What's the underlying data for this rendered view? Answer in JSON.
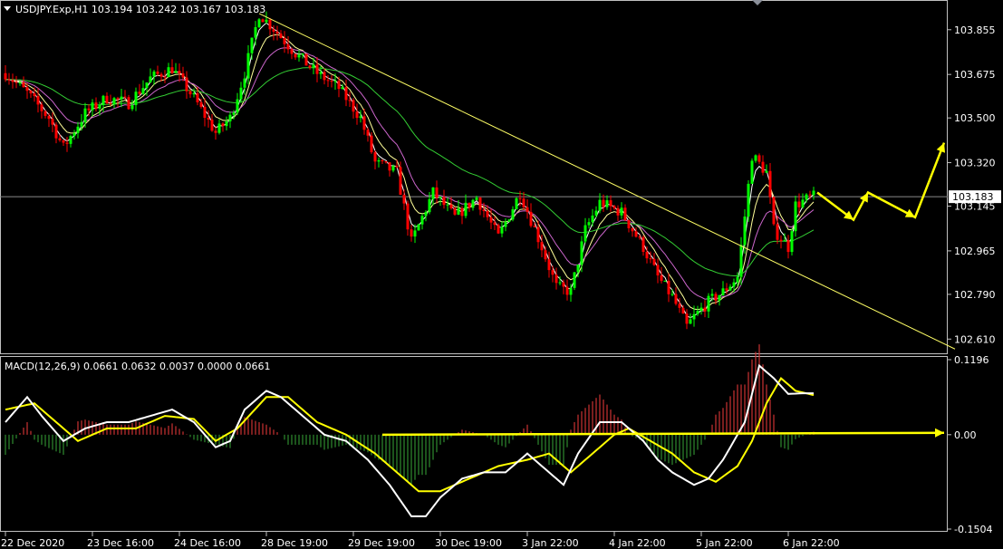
{
  "header": {
    "symbol_line": "USDJPY.Exp,H1  103.194 103.242 103.167 103.183"
  },
  "macd_header": {
    "label": "MACD(12,26,9) 0.0661 0.0632 0.0037 0.0000 0.0661"
  },
  "colors": {
    "background": "#000000",
    "bull": "#00ff00",
    "bear": "#ff0000",
    "trendline": "#ffff66",
    "arrow": "#ffff00",
    "ma_fast": "#ffffff",
    "ma_mid": "#ffff99",
    "ma_slow": "#cc66cc",
    "ma_long": "#33cc33",
    "macd_line": "#ffffff",
    "signal_line": "#ffff00",
    "hist_pos": "#cc3333",
    "hist_neg": "#2e8b2e"
  },
  "chart_data": [
    {
      "type": "candlestick",
      "title": "USDJPY.Exp,H1",
      "ylim": [
        102.56,
        103.96
      ],
      "y_ticks": [
        "103.855",
        "103.675",
        "103.500",
        "103.320",
        "103.145",
        "102.965",
        "102.790",
        "102.610"
      ],
      "y_tick_values": [
        103.855,
        103.675,
        103.5,
        103.32,
        103.145,
        102.965,
        102.79,
        102.61
      ],
      "current_price_label": "103.183",
      "current_price": 103.183,
      "x_ticks": [
        "22 Dec 2020",
        "23 Dec 16:00",
        "24 Dec 16:00",
        "28 Dec 19:00",
        "29 Dec 19:00",
        "30 Dec 19:00",
        "3 Jan 22:00",
        "4 Jan 22:00",
        "5 Jan 22:00",
        "6 Jan 22:00"
      ],
      "x_tick_index": [
        0,
        24,
        48,
        72,
        96,
        120,
        144,
        168,
        192,
        216
      ],
      "bar_count": 224,
      "anchors": [
        [
          0,
          103.68
        ],
        [
          6,
          103.6
        ],
        [
          12,
          103.5
        ],
        [
          16,
          103.38
        ],
        [
          22,
          103.52
        ],
        [
          28,
          103.58
        ],
        [
          34,
          103.56
        ],
        [
          40,
          103.66
        ],
        [
          46,
          103.7
        ],
        [
          52,
          103.58
        ],
        [
          58,
          103.44
        ],
        [
          62,
          103.5
        ],
        [
          66,
          103.68
        ],
        [
          70,
          103.92
        ],
        [
          74,
          103.86
        ],
        [
          80,
          103.76
        ],
        [
          86,
          103.68
        ],
        [
          92,
          103.62
        ],
        [
          98,
          103.5
        ],
        [
          102,
          103.32
        ],
        [
          108,
          103.28
        ],
        [
          112,
          103.0
        ],
        [
          118,
          103.2
        ],
        [
          124,
          103.1
        ],
        [
          130,
          103.18
        ],
        [
          136,
          103.02
        ],
        [
          142,
          103.2
        ],
        [
          148,
          102.98
        ],
        [
          152,
          102.82
        ],
        [
          156,
          102.8
        ],
        [
          160,
          103.05
        ],
        [
          164,
          103.16
        ],
        [
          170,
          103.12
        ],
        [
          176,
          102.98
        ],
        [
          180,
          102.86
        ],
        [
          184,
          102.78
        ],
        [
          188,
          102.66
        ],
        [
          190,
          102.7
        ],
        [
          194,
          102.76
        ],
        [
          198,
          102.8
        ],
        [
          202,
          102.86
        ],
        [
          206,
          103.35
        ],
        [
          210,
          103.28
        ],
        [
          212,
          103.05
        ],
        [
          216,
          102.98
        ],
        [
          218,
          103.15
        ],
        [
          222,
          103.18
        ],
        [
          223,
          103.183
        ]
      ],
      "trendline": [
        [
          70,
          103.92
        ],
        [
          262,
          102.57
        ]
      ],
      "projection_arrow": [
        [
          224,
          103.2
        ],
        [
          234,
          103.09
        ],
        [
          238,
          103.2
        ],
        [
          251,
          103.1
        ],
        [
          259,
          103.4
        ]
      ]
    },
    {
      "type": "line",
      "title": "MACD(12,26,9)",
      "ylim": [
        -0.1504,
        0.1196
      ],
      "y_ticks": [
        "0.1196",
        "0.00",
        "-0.1504"
      ],
      "y_tick_values": [
        0.1196,
        0.0,
        -0.1504
      ],
      "series": [
        {
          "name": "MACD",
          "values": [
            [
              0,
              0.02
            ],
            [
              6,
              0.06
            ],
            [
              10,
              0.03
            ],
            [
              16,
              -0.01
            ],
            [
              22,
              0.01
            ],
            [
              28,
              0.02
            ],
            [
              34,
              0.02
            ],
            [
              40,
              0.03
            ],
            [
              46,
              0.04
            ],
            [
              52,
              0.02
            ],
            [
              58,
              -0.02
            ],
            [
              62,
              -0.01
            ],
            [
              66,
              0.04
            ],
            [
              72,
              0.07
            ],
            [
              76,
              0.06
            ],
            [
              82,
              0.03
            ],
            [
              88,
              0.0
            ],
            [
              94,
              -0.01
            ],
            [
              100,
              -0.04
            ],
            [
              106,
              -0.08
            ],
            [
              112,
              -0.13
            ],
            [
              116,
              -0.13
            ],
            [
              120,
              -0.1
            ],
            [
              126,
              -0.07
            ],
            [
              132,
              -0.06
            ],
            [
              138,
              -0.06
            ],
            [
              144,
              -0.03
            ],
            [
              150,
              -0.06
            ],
            [
              154,
              -0.08
            ],
            [
              158,
              -0.03
            ],
            [
              164,
              0.02
            ],
            [
              170,
              0.02
            ],
            [
              176,
              -0.01
            ],
            [
              180,
              -0.04
            ],
            [
              184,
              -0.06
            ],
            [
              190,
              -0.08
            ],
            [
              194,
              -0.07
            ],
            [
              198,
              -0.04
            ],
            [
              204,
              0.02
            ],
            [
              208,
              0.11
            ],
            [
              212,
              0.09
            ],
            [
              216,
              0.065
            ],
            [
              220,
              0.066
            ],
            [
              223,
              0.0661
            ]
          ]
        },
        {
          "name": "Signal",
          "values": [
            [
              0,
              0.04
            ],
            [
              8,
              0.05
            ],
            [
              14,
              0.02
            ],
            [
              20,
              -0.01
            ],
            [
              28,
              0.01
            ],
            [
              36,
              0.01
            ],
            [
              44,
              0.03
            ],
            [
              52,
              0.025
            ],
            [
              58,
              -0.01
            ],
            [
              64,
              0.01
            ],
            [
              72,
              0.06
            ],
            [
              78,
              0.06
            ],
            [
              86,
              0.02
            ],
            [
              94,
              0.0
            ],
            [
              102,
              -0.03
            ],
            [
              108,
              -0.06
            ],
            [
              114,
              -0.09
            ],
            [
              120,
              -0.09
            ],
            [
              128,
              -0.07
            ],
            [
              136,
              -0.05
            ],
            [
              144,
              -0.04
            ],
            [
              150,
              -0.03
            ],
            [
              156,
              -0.06
            ],
            [
              162,
              -0.03
            ],
            [
              168,
              0.0
            ],
            [
              172,
              0.01
            ],
            [
              178,
              -0.01
            ],
            [
              184,
              -0.03
            ],
            [
              190,
              -0.06
            ],
            [
              196,
              -0.075
            ],
            [
              202,
              -0.05
            ],
            [
              206,
              -0.01
            ],
            [
              210,
              0.05
            ],
            [
              214,
              0.09
            ],
            [
              218,
              0.07
            ],
            [
              223,
              0.0632
            ]
          ]
        }
      ],
      "flat_arrow": [
        [
          104,
          0.0
        ],
        [
          259,
          0.003
        ]
      ]
    }
  ]
}
